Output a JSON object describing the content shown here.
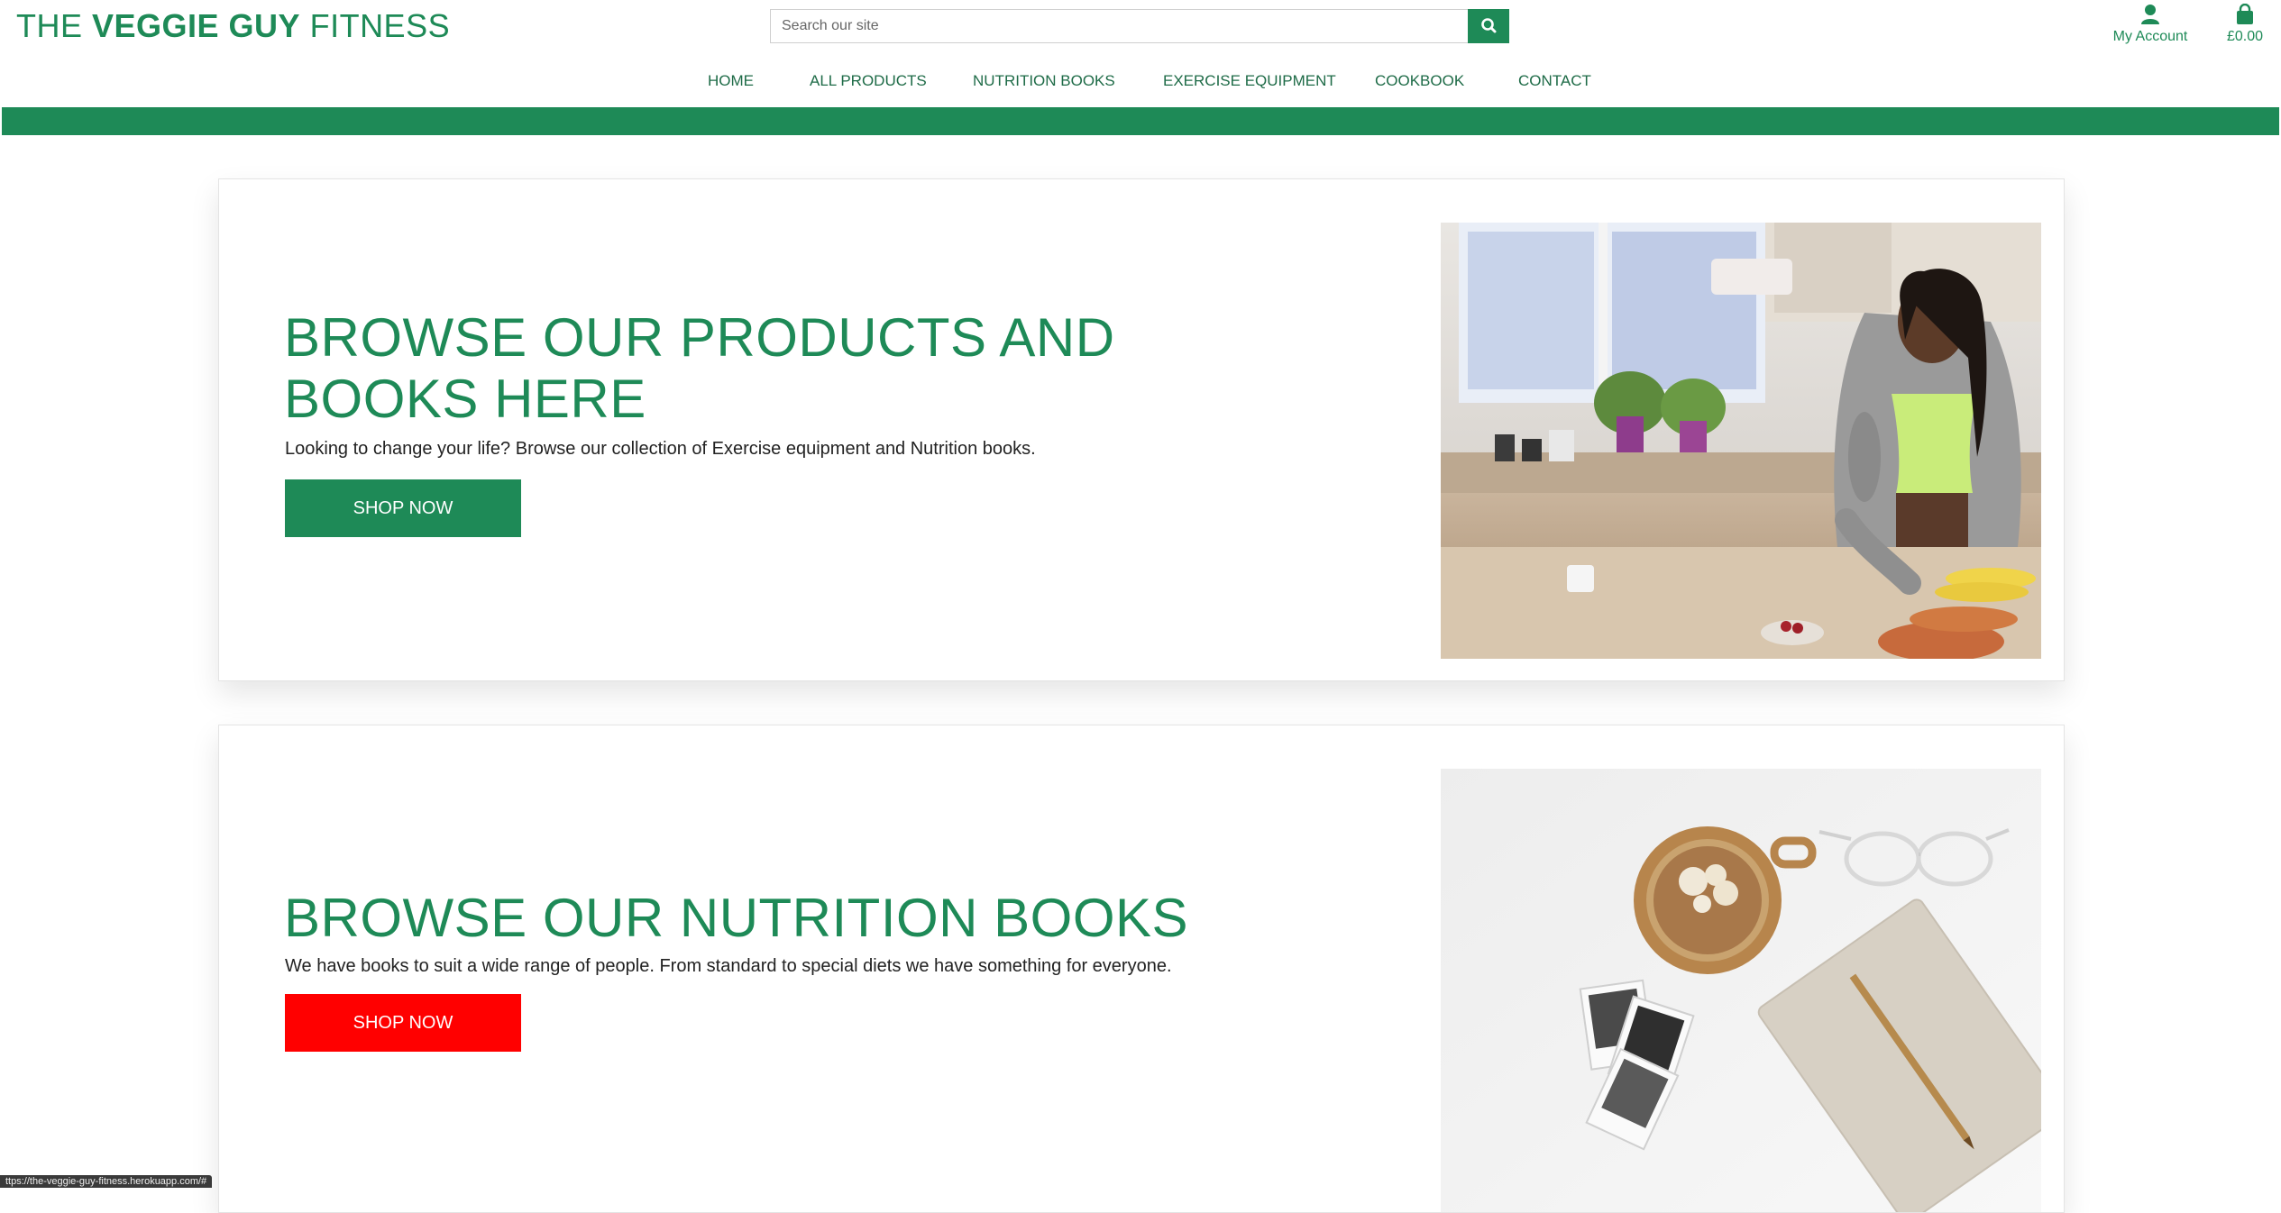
{
  "header": {
    "logo_prefix": "THE ",
    "logo_bold": "VEGGIE GUY",
    "logo_suffix": " FITNESS",
    "search_placeholder": "Search our site",
    "search_icon": "magnifier-icon",
    "account_label": "My Account",
    "account_icon": "user-icon",
    "cart_total": "£0.00",
    "cart_icon": "shopping-bag-icon"
  },
  "nav": {
    "items": [
      {
        "label": "HOME"
      },
      {
        "label": "ALL PRODUCTS"
      },
      {
        "label": "NUTRITION BOOKS"
      },
      {
        "label": "EXERCISE EQUIPMENT"
      },
      {
        "label": "COOKBOOK"
      },
      {
        "label": "CONTACT"
      }
    ]
  },
  "sections": [
    {
      "title": "BROWSE OUR PRODUCTS AND BOOKS HERE",
      "text": "Looking to change your life? Browse our collection of Exercise equipment and Nutrition books.",
      "button": "SHOP NOW",
      "button_color": "#1e8a57"
    },
    {
      "title": "BROWSE OUR NUTRITION BOOKS",
      "text": "We have books to suit a wide range of people. From standard to special diets we have something for everyone.",
      "button": "SHOP NOW",
      "button_color": "#ff0000"
    }
  ],
  "status_bar": "ttps://the-veggie-guy-fitness.herokuapp.com/#",
  "colors": {
    "brand_green": "#1e8a57",
    "nav_text": "#1e6b47",
    "accent_red": "#ff0000"
  }
}
